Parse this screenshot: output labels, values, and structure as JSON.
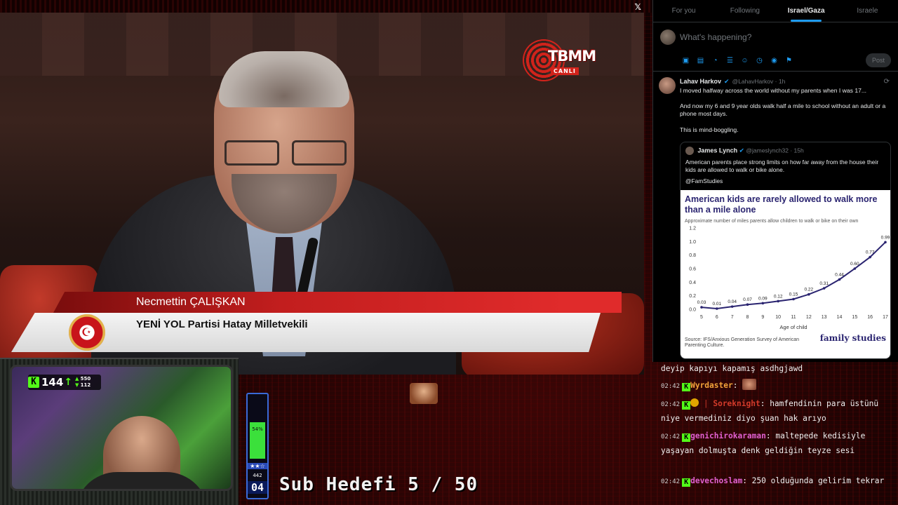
{
  "top": {
    "x_logo": "𝕏"
  },
  "broadcast": {
    "channel_logo": "TBMM",
    "live_label": "CANLI",
    "speaker_name": "Necmettin ÇALIŞKAN",
    "speaker_title": "YENİ YOL Partisi Hatay Milletvekili"
  },
  "x": {
    "tabs": [
      {
        "label": "For you",
        "active": false
      },
      {
        "label": "Following",
        "active": false
      },
      {
        "label": "Israel/Gaza",
        "active": true
      },
      {
        "label": "Israele",
        "active": false
      }
    ],
    "compose_placeholder": "What's happening?",
    "post_label": "Post",
    "tweet": {
      "name": "Lahav Harkov",
      "handle_time": "@LahavHarkov · 1h",
      "paragraphs": [
        "I moved halfway across the world without my parents when I was 17...",
        "And now my 6 and 9 year olds walk half a mile to school without an adult or a phone most days.",
        "This is mind-boggling."
      ],
      "quote": {
        "name": "James Lynch",
        "handle_time": "@jameslynch32 · 15h",
        "paragraphs": [
          "American parents place strong limits on how far away from the house their kids are allowed to walk or bike alone.",
          "@FamStudies"
        ]
      }
    }
  },
  "chart_data": {
    "type": "line",
    "title": "American kids are rarely allowed to walk more than a mile alone",
    "subtitle": "Approximate number of miles parents allow children to walk or bike on their own",
    "xlabel": "Age of child",
    "ylabel": "",
    "x": [
      5,
      6,
      7,
      8,
      9,
      10,
      11,
      12,
      13,
      14,
      15,
      16,
      17
    ],
    "series": [
      {
        "values": [
          0.03,
          0.01,
          0.04,
          0.07,
          0.09,
          0.12,
          0.15,
          0.22,
          0.31,
          0.44,
          0.6,
          0.77,
          0.99
        ]
      }
    ],
    "ylim": [
      0,
      1.2
    ],
    "yticks": [
      "0.0",
      "0.2",
      "0.4",
      "0.6",
      "0.8",
      "1.0",
      "1.2"
    ],
    "point_labels": [
      "0.03",
      "0.01",
      "0.04",
      "0.07",
      "0.09",
      "0.12",
      "0.15",
      "0.22",
      "0.31",
      "0.44",
      "0.60",
      "0.77",
      "0.99"
    ],
    "source": "Source: IFS/Anxious Generation Survey of American Parenting Culture.",
    "brand": "family studies",
    "color": "#2a2470"
  },
  "webcam": {
    "viewers": "144",
    "stat1": "550",
    "stat2": "112"
  },
  "subgoal": {
    "percent": "54%",
    "stars": "★★☆",
    "sub_count": "442",
    "number": "04",
    "text": "Sub Hedefi 5 / 50",
    "progress": 0.54
  },
  "chat": [
    {
      "time": "",
      "user": "",
      "user_class": "",
      "message": "deyip kapıyı kapamış asdhgjawd",
      "emote": false,
      "badge": false
    },
    {
      "time": "02:42",
      "user": "Wyrdaster",
      "user_class": "u-orange",
      "message": "",
      "emote": true,
      "badge": false
    },
    {
      "time": "02:42",
      "user": "Soreknight",
      "user_class": "u-red",
      "message": "hamfendinin para üstünü niye vermediniz diyo şuan hak arıyo",
      "emote": false,
      "badge": true
    },
    {
      "time": "02:42",
      "user": "genichirokaraman",
      "user_class": "u-pink",
      "message": "maltepede kedisiyle yaşayan dolmuşta denk geldiğin teyze sesi",
      "emote": false,
      "badge": false
    },
    {
      "time": "02:42",
      "user": "devechoslam",
      "user_class": "u-pink",
      "message": "250 olduğunda gelirim tekrar",
      "emote": false,
      "badge": false
    }
  ]
}
